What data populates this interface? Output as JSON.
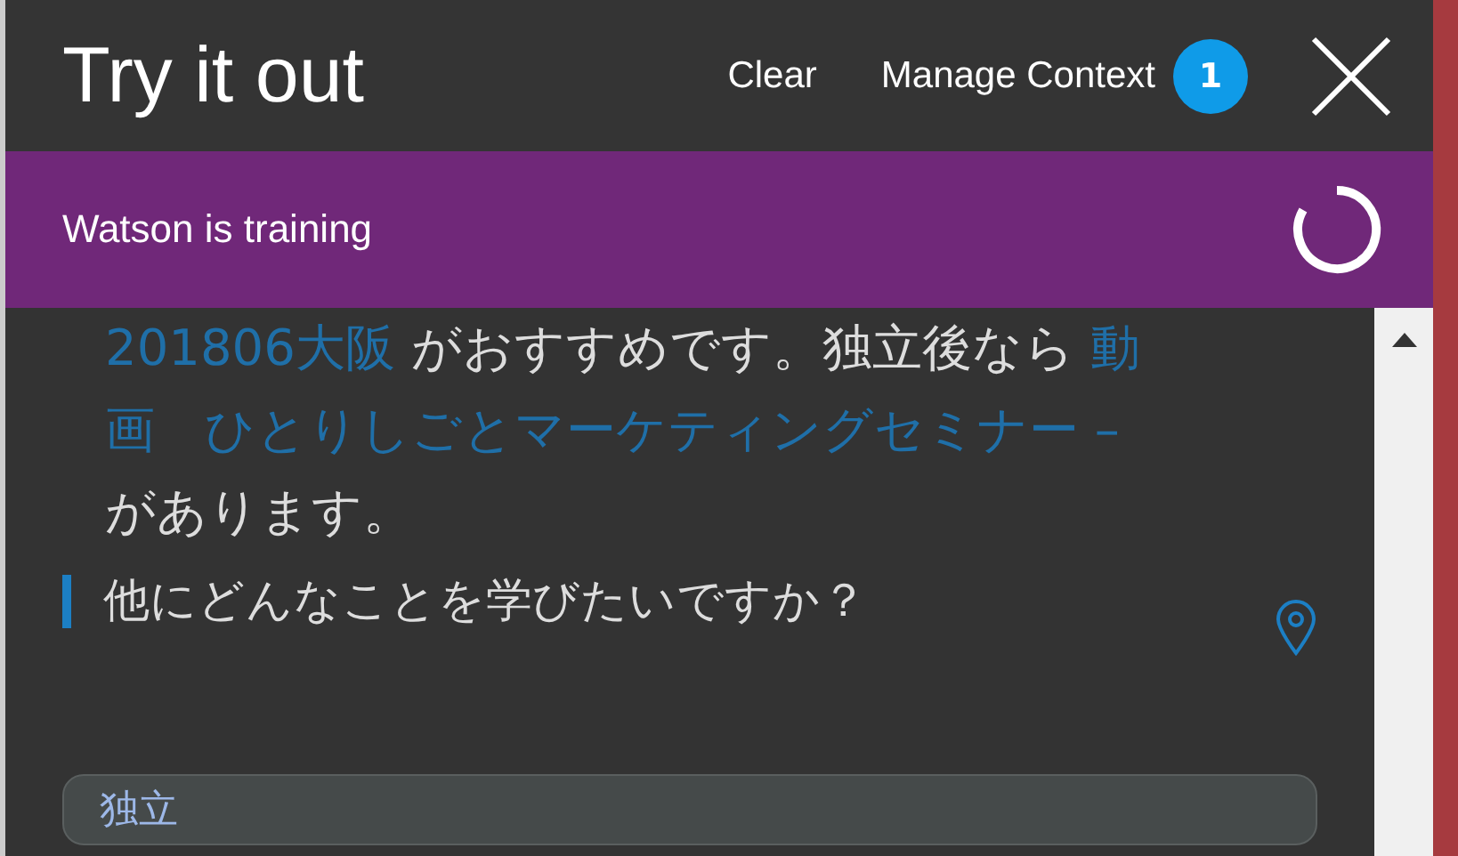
{
  "header": {
    "title": "Try it out",
    "clear": "Clear",
    "manage_context": "Manage Context",
    "context_count": "1"
  },
  "banner": {
    "text": "Watson is training"
  },
  "messages": [
    {
      "kind": "answer",
      "parts": [
        {
          "kind": "link",
          "text": "201806大阪"
        },
        {
          "kind": "text",
          "text": " がおすすめです。独立後なら "
        },
        {
          "kind": "link",
          "text": "動画　ひとりしごとマーケティングセミナー –"
        },
        {
          "kind": "text",
          "text": " があります。"
        }
      ]
    },
    {
      "kind": "question",
      "text": "他にどんなことを学びたいですか？"
    }
  ],
  "input": {
    "value": "独立"
  }
}
